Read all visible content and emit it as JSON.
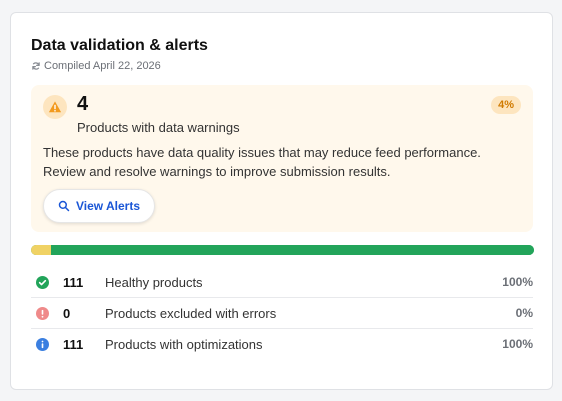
{
  "card": {
    "title": "Data validation & alerts",
    "compiled": "Compiled April 22, 2026",
    "compiled_icon": "refresh-icon"
  },
  "alert": {
    "icon": "warning-icon",
    "count": "4",
    "label": "Products with data warnings",
    "percent": "4%",
    "description": "These products have data quality issues that may reduce feed performance. Review and resolve warnings to improve submission results.",
    "button_label": "View Alerts",
    "button_icon": "search-icon"
  },
  "bar": {
    "segments": [
      {
        "name": "warnings",
        "fraction": 0.04,
        "color": "#f0d264"
      },
      {
        "name": "healthy",
        "fraction": 0.96,
        "color": "#22a45a"
      }
    ]
  },
  "stats": [
    {
      "icon": "check-circle-icon",
      "color": "#22a45a",
      "count": "111",
      "label": "Healthy products",
      "percent": "100%"
    },
    {
      "icon": "error-circle-icon",
      "color": "#ef8a8a",
      "count": "0",
      "label": "Products excluded with errors",
      "percent": "0%"
    },
    {
      "icon": "info-circle-icon",
      "color": "#3b7fe0",
      "count": "111",
      "label": "Products with optimizations",
      "percent": "100%"
    }
  ],
  "colors": {
    "alert_bg": "#fff8ec",
    "accent_orange": "#d07a00",
    "link_blue": "#1a56d6"
  }
}
